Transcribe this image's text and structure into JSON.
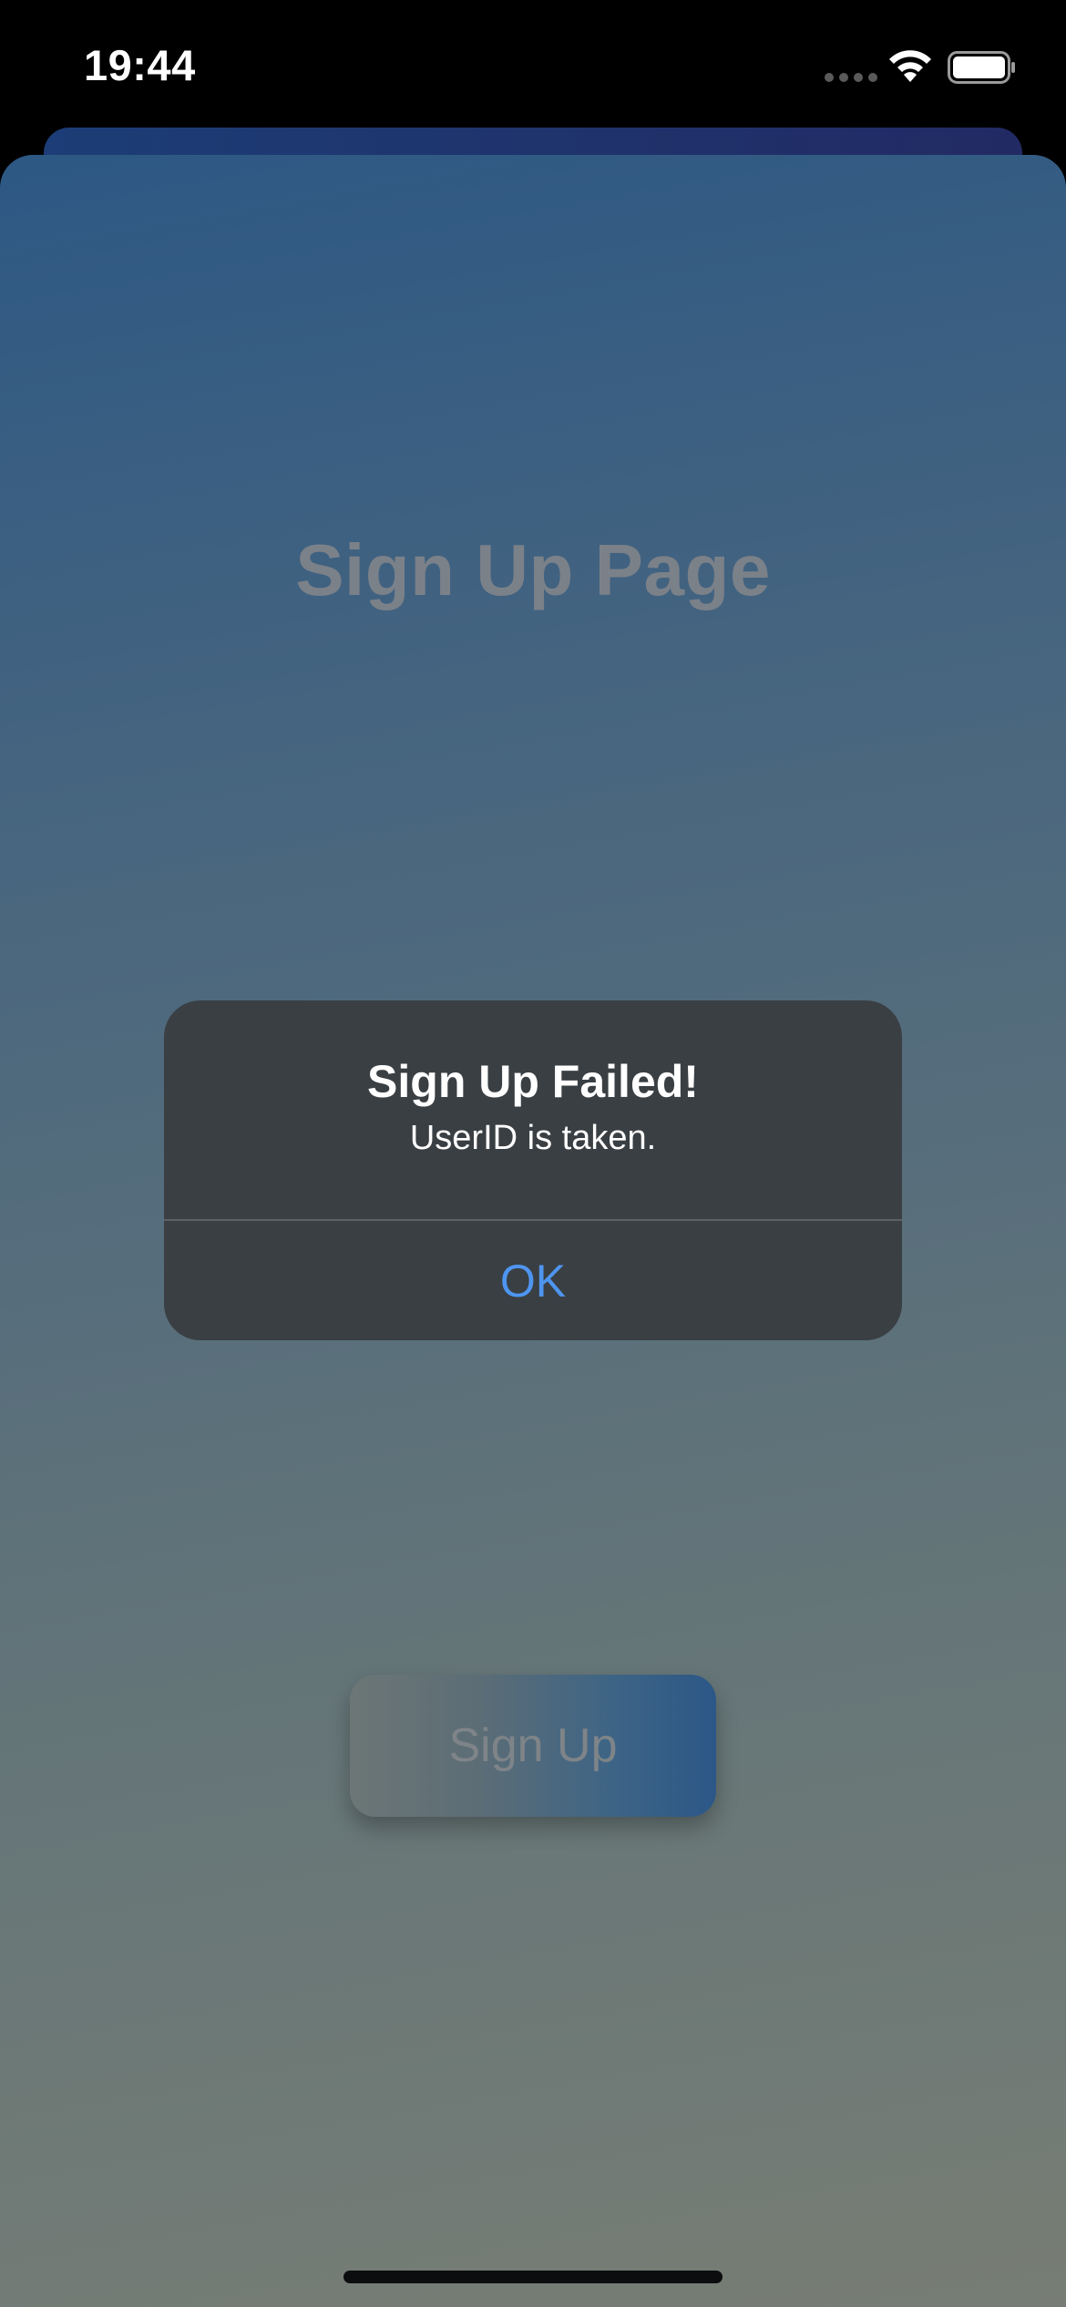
{
  "status_bar": {
    "time": "19:44"
  },
  "page": {
    "title": "Sign Up Page",
    "signup_button_label": "Sign Up"
  },
  "alert": {
    "title": "Sign Up Failed!",
    "message": "UserID is taken.",
    "ok_label": "OK"
  },
  "colors": {
    "alert_background": "#3a3f43",
    "alert_action": "#4e95ef",
    "sheet_top": "#2d5884",
    "sheet_bottom": "#777d74"
  },
  "icons": [
    "signal-icon",
    "wifi-icon",
    "battery-icon"
  ]
}
